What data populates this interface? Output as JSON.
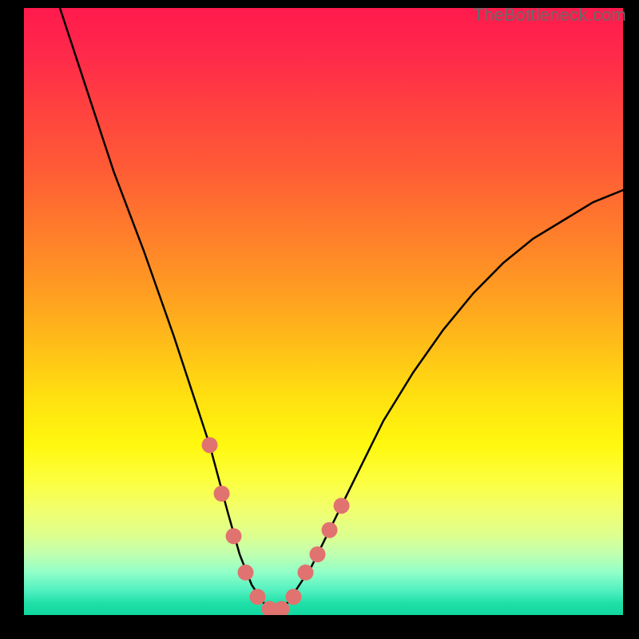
{
  "watermark": "TheBottleneck.com",
  "chart_data": {
    "type": "line",
    "title": "",
    "xlabel": "",
    "ylabel": "",
    "xlim": [
      0,
      100
    ],
    "ylim": [
      0,
      100
    ],
    "grid": false,
    "legend": false,
    "series": [
      {
        "name": "curve",
        "x": [
          6,
          10,
          15,
          20,
          25,
          28,
          31,
          34,
          36,
          38,
          40,
          42,
          44,
          48,
          52,
          56,
          60,
          65,
          70,
          75,
          80,
          85,
          90,
          95,
          100
        ],
        "y": [
          100,
          88,
          73,
          60,
          46,
          37,
          28,
          17,
          10,
          5,
          2,
          1,
          2,
          8,
          16,
          24,
          32,
          40,
          47,
          53,
          58,
          62,
          65,
          68,
          70
        ],
        "color": "#000000"
      }
    ],
    "markers": [
      {
        "x": 31,
        "y": 28,
        "color": "#e0736f"
      },
      {
        "x": 33,
        "y": 20,
        "color": "#e0736f"
      },
      {
        "x": 35,
        "y": 13,
        "color": "#e0736f"
      },
      {
        "x": 37,
        "y": 7,
        "color": "#e0736f"
      },
      {
        "x": 39,
        "y": 3,
        "color": "#e0736f"
      },
      {
        "x": 41,
        "y": 1,
        "color": "#e0736f"
      },
      {
        "x": 43,
        "y": 1,
        "color": "#e0736f"
      },
      {
        "x": 45,
        "y": 3,
        "color": "#e0736f"
      },
      {
        "x": 47,
        "y": 7,
        "color": "#e0736f"
      },
      {
        "x": 49,
        "y": 10,
        "color": "#e0736f"
      },
      {
        "x": 51,
        "y": 14,
        "color": "#e0736f"
      },
      {
        "x": 53,
        "y": 18,
        "color": "#e0736f"
      }
    ],
    "background_gradient": {
      "top": "#ff1a4d",
      "mid": "#ffe010",
      "bottom": "#10d8a0"
    }
  }
}
